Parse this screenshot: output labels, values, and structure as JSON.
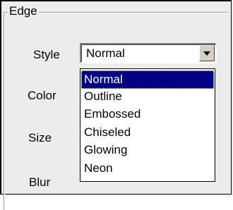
{
  "group": {
    "title": "Edge"
  },
  "fields": {
    "style_label": "Style",
    "color_label": "Color",
    "size_label": "Size",
    "blur_label": "Blur"
  },
  "style_combo": {
    "value": "Normal",
    "options": [
      "Normal",
      "Outline",
      "Embossed",
      "Chiseled",
      "Glowing",
      "Neon"
    ],
    "selected_index": 0
  },
  "colors": {
    "selection": "#000080",
    "panel": "#ececec"
  }
}
